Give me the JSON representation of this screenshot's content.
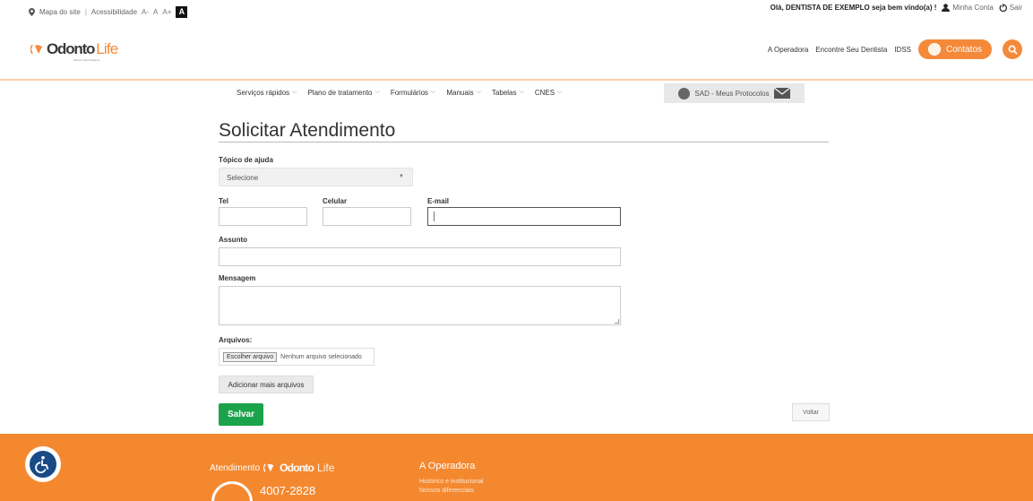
{
  "topbar": {
    "sitemap": "Mapa do site",
    "accessibility": "Acessibilidade",
    "font_smaller": "A-",
    "font_normal": "A",
    "font_bigger": "A+",
    "contrast": "A",
    "greeting": "Olá, DENTISTA DE EXEMPLO seja bem vindo(a) !",
    "my_account": "Minha Conta",
    "logout": "Sair"
  },
  "brand": {
    "name_part1": "Odonto",
    "name_part2": "Life",
    "tagline": "Planos Odontológicos"
  },
  "mainnav": {
    "items": [
      "A Operadora",
      "Encontre Seu Dentista",
      "IDSS"
    ],
    "contatos": "Contatos"
  },
  "subnav": {
    "items": [
      "Serviços rápidos",
      "Plano de tratamento",
      "Formulários",
      "Manuais",
      "Tabelas",
      "CNES"
    ],
    "sad": "SAD - Meus Protocolos"
  },
  "form": {
    "title": "Solicitar Atendimento",
    "topic_label": "Tópico de ajuda",
    "topic_value": "Selecione",
    "tel_label": "Tel",
    "cel_label": "Celular",
    "email_label": "E-mail",
    "subject_label": "Assunto",
    "message_label": "Mensagem",
    "files_label": "Arquivos:",
    "choose_file": "Escolher arquivo",
    "no_file": "Nenhum arquivo selecionado",
    "add_more": "Adicionar mais arquivos",
    "save": "Salvar",
    "back": "Voltar"
  },
  "footer": {
    "atendimento": "Atendimento",
    "brand1": "Odonto",
    "brand2": "Life",
    "phone": "4007-2828",
    "operadora": "A Operadora",
    "links": [
      "Histórico e institucional",
      "Nossos diferenciais"
    ]
  },
  "colors": {
    "accent": "#f5893a",
    "save_green": "#1aa34a",
    "footer": "#f4882f"
  }
}
